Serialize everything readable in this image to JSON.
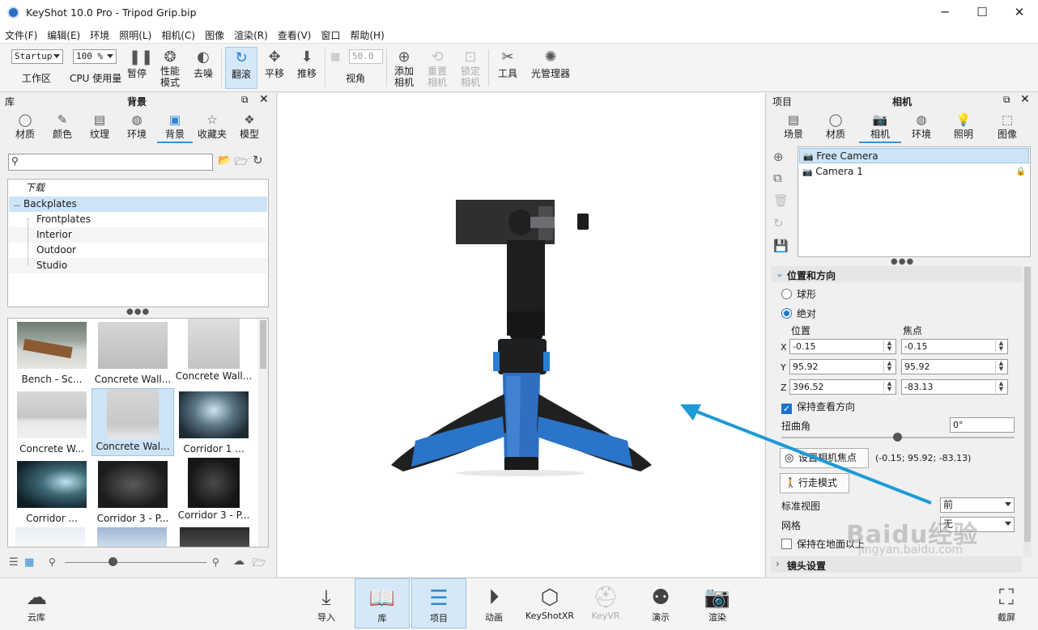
{
  "window": {
    "title": "KeyShot 10.0 Pro  - Tripod Grip.bip",
    "min": "─",
    "max": "☐",
    "close": "✕"
  },
  "menu": [
    "文件(F)",
    "编辑(E)",
    "环境",
    "照明(L)",
    "相机(C)",
    "图像",
    "渲染(R)",
    "查看(V)",
    "窗口",
    "帮助(H)"
  ],
  "toolbar": {
    "workspace_value": "Startup",
    "workspace_label": "工作区",
    "cpu_value": "100 %",
    "cpu_label": "CPU 使用量",
    "pause": "暂停",
    "performance": "性能\n模式",
    "denoise": "去噪",
    "tumble": "翻滚",
    "pan": "平移",
    "dolly": "推移",
    "fov_value": "50.0",
    "fov_label": "视角",
    "add_camera": "添加\n相机",
    "reset_camera": "重置\n相机",
    "lock_camera": "锁定\n相机",
    "tools": "工具",
    "light_manager": "光管理器"
  },
  "library": {
    "header_left": "库",
    "header_title": "背景",
    "tabs": [
      "材质",
      "颜色",
      "纹理",
      "环境",
      "背景",
      "收藏夹",
      "模型"
    ],
    "active_tab": "背景",
    "tree": [
      "下载",
      "Backplates",
      "Frontplates",
      "Interior",
      "Outdoor",
      "Studio"
    ],
    "thumbnails": [
      "Bench - Sc...",
      "Concrete Wall...",
      "Concrete Wall...",
      "Concrete W...",
      "Concrete Wal...",
      "Corridor 1 ...",
      "Corridor ...",
      "Corridor 3 - P...",
      "Corridor 3 - P..."
    ]
  },
  "project": {
    "header_left": "项目",
    "header_title": "相机",
    "tabs": [
      "场景",
      "材质",
      "相机",
      "环境",
      "照明",
      "图像"
    ],
    "active_tab": "相机",
    "cameras": [
      "Free Camera",
      "Camera 1"
    ],
    "section_title": "位置和方向",
    "spherical": "球形",
    "absolute": "绝对",
    "position_label": "位置",
    "focus_label": "焦点",
    "axes": [
      "X",
      "Y",
      "Z"
    ],
    "position": [
      "-0.15",
      "95.92",
      "396.52"
    ],
    "focus": [
      "-0.15",
      "95.92",
      "-83.13"
    ],
    "keep_look": "保持查看方向",
    "twist_label": "扭曲角",
    "twist_value": "0°",
    "set_focus_btn": "设置相机焦点",
    "focus_readout": "(-0.15; 95.92; -83.13)",
    "walk_btn": "行走模式",
    "std_view_label": "标准视图",
    "std_view_value": "前",
    "grid_label": "网格",
    "grid_value": "无",
    "keep_above": "保持在地面以上",
    "lens_section": "镜头设置"
  },
  "bottom": {
    "cloud": "云库",
    "import": "导入",
    "library": "库",
    "project": "项目",
    "animation": "动画",
    "keyshotxr": "KeyShotXR",
    "keyvr": "KeyVR",
    "present": "演示",
    "render": "渲染",
    "screenshot": "截屏"
  },
  "watermark": "Baidu经验",
  "watermark_url": "jingyan.baidu.com",
  "colors": {
    "accent": "#2e86d3",
    "arrow": "#1e9ad6",
    "selection": "#cde4f7",
    "viewport": "#ffffff"
  }
}
